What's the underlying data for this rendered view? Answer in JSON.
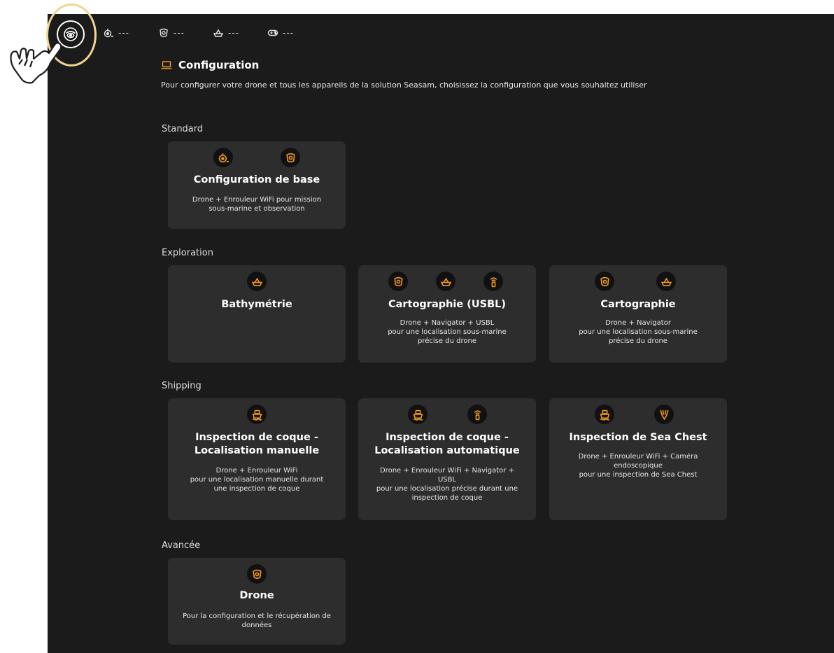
{
  "colors": {
    "accent": "#f39a1f",
    "background": "#1b1b1b",
    "card": "#2d2d2d",
    "highlight": "#f2d591"
  },
  "topbar": {
    "main_icon": "seasam-logo-icon",
    "statuses": [
      {
        "icon": "drone-reel-icon",
        "value": "---"
      },
      {
        "icon": "drone-icon",
        "value": "---"
      },
      {
        "icon": "navigator-icon",
        "value": "---"
      },
      {
        "icon": "gamepad-icon",
        "value": "---"
      }
    ]
  },
  "header": {
    "title_icon": "laptop-icon",
    "title": "Configuration",
    "subtitle": "Pour configurer votre drone et tous les appareils de la solution Seasam, choisissez la configuration que vous souhaitez utiliser"
  },
  "sections": [
    {
      "name": "Standard",
      "cards": [
        {
          "title": "Configuration de base",
          "description": "Drone + Enrouleur WiFi pour mission\nsous-marine et observation",
          "icons": [
            "reel-icon",
            "drone-icon"
          ]
        }
      ]
    },
    {
      "name": "Exploration",
      "cards": [
        {
          "title": "Bathymétrie",
          "description": "",
          "icons": [
            "navigator-icon"
          ]
        },
        {
          "title": "Cartographie (USBL)",
          "description": "Drone + Navigator + USBL\npour une localisation sous-marine\nprécise du drone",
          "icons": [
            "drone-icon",
            "navigator-icon",
            "usbl-icon"
          ]
        },
        {
          "title": "Cartographie",
          "description": "Drone + Navigator\npour une localisation sous-marine\nprécise du drone",
          "icons": [
            "drone-icon",
            "navigator-icon"
          ]
        }
      ]
    },
    {
      "name": "Shipping",
      "cards": [
        {
          "title": "Inspection de coque -\nLocalisation manuelle",
          "description": "Drone + Enrouleur WiFi\npour une localisation manuelle durant\nune inspection de coque",
          "icons": [
            "ship-icon"
          ]
        },
        {
          "title": "Inspection de coque -\nLocalisation automatique",
          "description": "Drone + Enrouleur WiFi + Navigator +\nUSBL\npour une localisation précise durant une\ninspection de coque",
          "icons": [
            "ship-icon",
            "usbl-icon"
          ]
        },
        {
          "title": "Inspection de Sea Chest",
          "description": "Drone + Enrouleur WiFi + Caméra\nendoscopique\npour une inspection de Sea Chest",
          "icons": [
            "ship-icon",
            "endoscope-icon"
          ]
        }
      ]
    },
    {
      "name": "Avancée",
      "cards": [
        {
          "title": "Drone",
          "description": "Pour la configuration et le récupération de\ndonnées",
          "icons": [
            "drone-icon"
          ]
        }
      ]
    }
  ]
}
